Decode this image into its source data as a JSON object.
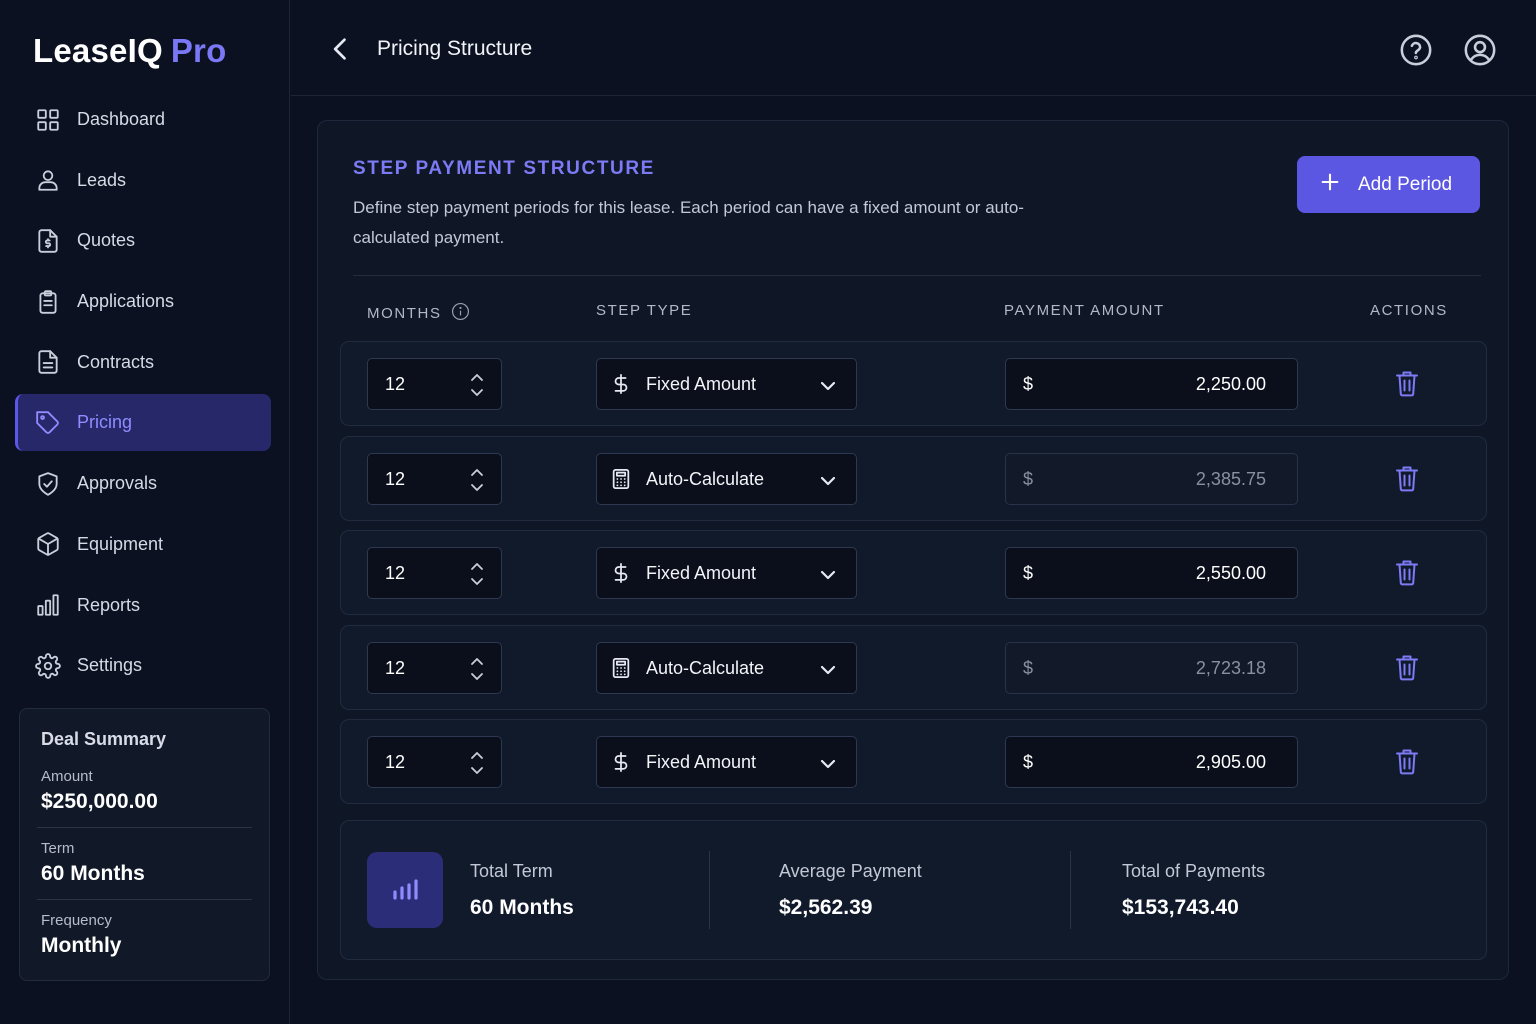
{
  "brand": {
    "name": "LeaseIQ",
    "suffix": "Pro"
  },
  "nav": {
    "items": [
      {
        "label": "Dashboard",
        "icon": "dashboard-icon"
      },
      {
        "label": "Leads",
        "icon": "user-icon"
      },
      {
        "label": "Quotes",
        "icon": "quote-document-icon"
      },
      {
        "label": "Applications",
        "icon": "clipboard-icon"
      },
      {
        "label": "Contracts",
        "icon": "contract-document-icon"
      },
      {
        "label": "Pricing",
        "icon": "tag-icon",
        "active": true
      },
      {
        "label": "Approvals",
        "icon": "shield-check-icon"
      },
      {
        "label": "Equipment",
        "icon": "box-icon"
      },
      {
        "label": "Reports",
        "icon": "bar-chart-icon"
      },
      {
        "label": "Settings",
        "icon": "gear-icon"
      }
    ]
  },
  "deal_summary": {
    "title": "Deal Summary",
    "amount_label": "Amount",
    "amount_value": "$250,000.00",
    "term_label": "Term",
    "term_value": "60 Months",
    "frequency_label": "Frequency",
    "frequency_value": "Monthly"
  },
  "header": {
    "title": "Pricing Structure"
  },
  "section": {
    "title": "STEP PAYMENT STRUCTURE",
    "description": "Define step payment periods for this lease. Each period can have a fixed amount or auto-calculated payment.",
    "add_button": "Add Period"
  },
  "columns": {
    "months": "MONTHS",
    "step_type": "STEP TYPE",
    "payment_amount": "PAYMENT AMOUNT",
    "actions": "ACTIONS"
  },
  "periods": [
    {
      "months": "12",
      "step_type": "Fixed Amount",
      "type_icon": "dollar-icon",
      "currency": "$",
      "amount": "2,250.00",
      "auto": false
    },
    {
      "months": "12",
      "step_type": "Auto-Calculate",
      "type_icon": "calculator-icon",
      "currency": "$",
      "amount": "2,385.75",
      "auto": true
    },
    {
      "months": "12",
      "step_type": "Fixed Amount",
      "type_icon": "dollar-icon",
      "currency": "$",
      "amount": "2,550.00",
      "auto": false
    },
    {
      "months": "12",
      "step_type": "Auto-Calculate",
      "type_icon": "calculator-icon",
      "currency": "$",
      "amount": "2,723.18",
      "auto": true
    },
    {
      "months": "12",
      "step_type": "Fixed Amount",
      "type_icon": "dollar-icon",
      "currency": "$",
      "amount": "2,905.00",
      "auto": false
    }
  ],
  "summary": {
    "total_term_label": "Total Term",
    "total_term_value": "60 Months",
    "average_payment_label": "Average Payment",
    "average_payment_value": "$2,562.39",
    "total_payments_label": "Total of Payments",
    "total_payments_value": "$153,743.40"
  },
  "colors": {
    "accent": "#5b57e3",
    "accent_text": "#7d7af5",
    "background": "#0b1120",
    "panel": "#0f1626"
  }
}
